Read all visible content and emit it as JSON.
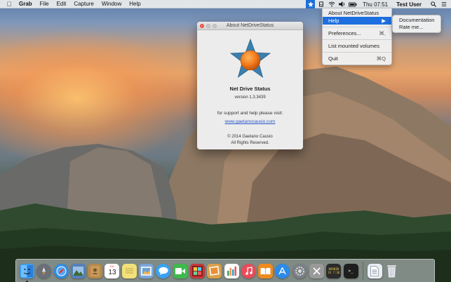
{
  "menubar": {
    "apple_icon": "apple-icon",
    "items": [
      "Grab",
      "File",
      "Edit",
      "Capture",
      "Window",
      "Help"
    ],
    "status_icons": [
      "netdrivestatus-icon",
      "drive-icon",
      "wifi-icon",
      "volume-icon",
      "battery-icon"
    ],
    "clock": "Thu 07:51",
    "user": "Test User",
    "search_icon": "search-icon",
    "list_icon": "list-icon"
  },
  "dropdown": {
    "items": [
      {
        "label": "About NetDriveStatus",
        "shortcut": ""
      },
      {
        "label": "Help",
        "shortcut": "▶"
      },
      {
        "label": "Preferences...",
        "shortcut": "⌘,"
      },
      {
        "label": "List mounted volumes",
        "shortcut": ""
      },
      {
        "label": "Quit",
        "shortcut": "⌘Q"
      }
    ],
    "highlighted": "Help"
  },
  "submenu": {
    "items": [
      "Documentation",
      "Rate me..."
    ]
  },
  "about_window": {
    "title": "About NetDriveStatus",
    "app_name": "Net Drive Status",
    "version": "version 1.3.3439",
    "support_text": "for support and help please visit:",
    "link": "www.gaetanocausio.com",
    "copyright": "© 2014 Gaetano Causio",
    "rights": "All Rights Reserved.",
    "logo_colors": {
      "star": "#3b7fae",
      "orb": "#f07a1c"
    }
  },
  "dock": {
    "apps": [
      {
        "name": "finder",
        "glyph": "☺",
        "bg": "#3d9ef0"
      },
      {
        "name": "launchpad",
        "glyph": "🚀",
        "bg": "#6a6f78"
      },
      {
        "name": "safari",
        "glyph": "✦",
        "bg": "#2f8ee8"
      },
      {
        "name": "preview",
        "glyph": "▲",
        "bg": "#5580b8"
      },
      {
        "name": "contacts",
        "glyph": "@",
        "bg": "#b5884c"
      },
      {
        "name": "calendar",
        "glyph": "",
        "bg": "#ffffff"
      },
      {
        "name": "notes",
        "glyph": "≡",
        "bg": "#f3e07a"
      },
      {
        "name": "photos",
        "glyph": "✿",
        "bg": "#7aa6d8"
      },
      {
        "name": "messages",
        "glyph": "💬",
        "bg": "#3aa2f2"
      },
      {
        "name": "facetime",
        "glyph": "▶",
        "bg": "#3fb94d"
      },
      {
        "name": "photobooth",
        "glyph": "◉",
        "bg": "#c23a3a"
      },
      {
        "name": "iphoto",
        "glyph": "▣",
        "bg": "#d9a04a"
      },
      {
        "name": "numbers",
        "glyph": "▮",
        "bg": "#3aa35a"
      },
      {
        "name": "itunes",
        "glyph": "♫",
        "bg": "#e84c5a"
      },
      {
        "name": "ibooks",
        "glyph": "📖",
        "bg": "#ef8a1f"
      },
      {
        "name": "app-store",
        "glyph": "A",
        "bg": "#2d8be8"
      },
      {
        "name": "system-preferences",
        "glyph": "⚙",
        "bg": "#7b7f86"
      },
      {
        "name": "utility",
        "glyph": "✕",
        "bg": "#9a9a9a"
      },
      {
        "name": "console",
        "glyph": "",
        "bg": "#2b2b2b"
      },
      {
        "name": "terminal",
        "glyph": ">_",
        "bg": "#1e1e1e"
      }
    ],
    "calendar_month": "JUL",
    "calendar_day": "13",
    "console_text": [
      "WARNIN",
      "1V 7:36"
    ],
    "stack_icons": [
      "document-icon",
      "trash-icon"
    ]
  }
}
